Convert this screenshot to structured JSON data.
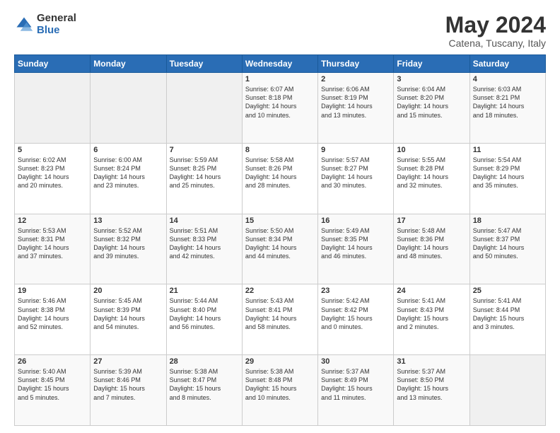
{
  "logo": {
    "general": "General",
    "blue": "Blue"
  },
  "title": "May 2024",
  "subtitle": "Catena, Tuscany, Italy",
  "weekdays": [
    "Sunday",
    "Monday",
    "Tuesday",
    "Wednesday",
    "Thursday",
    "Friday",
    "Saturday"
  ],
  "weeks": [
    [
      {
        "day": "",
        "info": ""
      },
      {
        "day": "",
        "info": ""
      },
      {
        "day": "",
        "info": ""
      },
      {
        "day": "1",
        "info": "Sunrise: 6:07 AM\nSunset: 8:18 PM\nDaylight: 14 hours\nand 10 minutes."
      },
      {
        "day": "2",
        "info": "Sunrise: 6:06 AM\nSunset: 8:19 PM\nDaylight: 14 hours\nand 13 minutes."
      },
      {
        "day": "3",
        "info": "Sunrise: 6:04 AM\nSunset: 8:20 PM\nDaylight: 14 hours\nand 15 minutes."
      },
      {
        "day": "4",
        "info": "Sunrise: 6:03 AM\nSunset: 8:21 PM\nDaylight: 14 hours\nand 18 minutes."
      }
    ],
    [
      {
        "day": "5",
        "info": "Sunrise: 6:02 AM\nSunset: 8:23 PM\nDaylight: 14 hours\nand 20 minutes."
      },
      {
        "day": "6",
        "info": "Sunrise: 6:00 AM\nSunset: 8:24 PM\nDaylight: 14 hours\nand 23 minutes."
      },
      {
        "day": "7",
        "info": "Sunrise: 5:59 AM\nSunset: 8:25 PM\nDaylight: 14 hours\nand 25 minutes."
      },
      {
        "day": "8",
        "info": "Sunrise: 5:58 AM\nSunset: 8:26 PM\nDaylight: 14 hours\nand 28 minutes."
      },
      {
        "day": "9",
        "info": "Sunrise: 5:57 AM\nSunset: 8:27 PM\nDaylight: 14 hours\nand 30 minutes."
      },
      {
        "day": "10",
        "info": "Sunrise: 5:55 AM\nSunset: 8:28 PM\nDaylight: 14 hours\nand 32 minutes."
      },
      {
        "day": "11",
        "info": "Sunrise: 5:54 AM\nSunset: 8:29 PM\nDaylight: 14 hours\nand 35 minutes."
      }
    ],
    [
      {
        "day": "12",
        "info": "Sunrise: 5:53 AM\nSunset: 8:31 PM\nDaylight: 14 hours\nand 37 minutes."
      },
      {
        "day": "13",
        "info": "Sunrise: 5:52 AM\nSunset: 8:32 PM\nDaylight: 14 hours\nand 39 minutes."
      },
      {
        "day": "14",
        "info": "Sunrise: 5:51 AM\nSunset: 8:33 PM\nDaylight: 14 hours\nand 42 minutes."
      },
      {
        "day": "15",
        "info": "Sunrise: 5:50 AM\nSunset: 8:34 PM\nDaylight: 14 hours\nand 44 minutes."
      },
      {
        "day": "16",
        "info": "Sunrise: 5:49 AM\nSunset: 8:35 PM\nDaylight: 14 hours\nand 46 minutes."
      },
      {
        "day": "17",
        "info": "Sunrise: 5:48 AM\nSunset: 8:36 PM\nDaylight: 14 hours\nand 48 minutes."
      },
      {
        "day": "18",
        "info": "Sunrise: 5:47 AM\nSunset: 8:37 PM\nDaylight: 14 hours\nand 50 minutes."
      }
    ],
    [
      {
        "day": "19",
        "info": "Sunrise: 5:46 AM\nSunset: 8:38 PM\nDaylight: 14 hours\nand 52 minutes."
      },
      {
        "day": "20",
        "info": "Sunrise: 5:45 AM\nSunset: 8:39 PM\nDaylight: 14 hours\nand 54 minutes."
      },
      {
        "day": "21",
        "info": "Sunrise: 5:44 AM\nSunset: 8:40 PM\nDaylight: 14 hours\nand 56 minutes."
      },
      {
        "day": "22",
        "info": "Sunrise: 5:43 AM\nSunset: 8:41 PM\nDaylight: 14 hours\nand 58 minutes."
      },
      {
        "day": "23",
        "info": "Sunrise: 5:42 AM\nSunset: 8:42 PM\nDaylight: 15 hours\nand 0 minutes."
      },
      {
        "day": "24",
        "info": "Sunrise: 5:41 AM\nSunset: 8:43 PM\nDaylight: 15 hours\nand 2 minutes."
      },
      {
        "day": "25",
        "info": "Sunrise: 5:41 AM\nSunset: 8:44 PM\nDaylight: 15 hours\nand 3 minutes."
      }
    ],
    [
      {
        "day": "26",
        "info": "Sunrise: 5:40 AM\nSunset: 8:45 PM\nDaylight: 15 hours\nand 5 minutes."
      },
      {
        "day": "27",
        "info": "Sunrise: 5:39 AM\nSunset: 8:46 PM\nDaylight: 15 hours\nand 7 minutes."
      },
      {
        "day": "28",
        "info": "Sunrise: 5:38 AM\nSunset: 8:47 PM\nDaylight: 15 hours\nand 8 minutes."
      },
      {
        "day": "29",
        "info": "Sunrise: 5:38 AM\nSunset: 8:48 PM\nDaylight: 15 hours\nand 10 minutes."
      },
      {
        "day": "30",
        "info": "Sunrise: 5:37 AM\nSunset: 8:49 PM\nDaylight: 15 hours\nand 11 minutes."
      },
      {
        "day": "31",
        "info": "Sunrise: 5:37 AM\nSunset: 8:50 PM\nDaylight: 15 hours\nand 13 minutes."
      },
      {
        "day": "",
        "info": ""
      }
    ]
  ]
}
